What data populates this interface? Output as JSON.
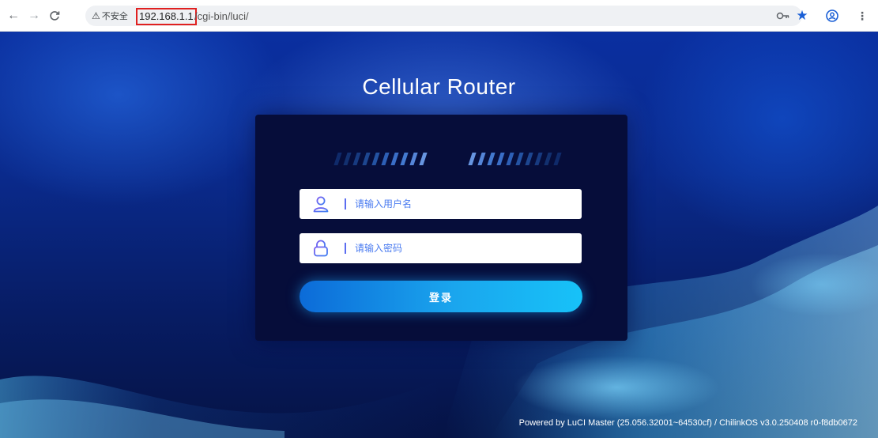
{
  "browser": {
    "security_label": "不安全",
    "url_host": "192.168.1.1",
    "url_path": "/cgi-bin/luci/"
  },
  "icons": {
    "back": "back-arrow-icon",
    "forward": "forward-arrow-icon",
    "reload": "reload-icon",
    "warning": "warning-icon",
    "key": "password-key-icon",
    "bookmark": "bookmark-star-icon",
    "profile": "profile-icon",
    "menu": "more-menu-icon",
    "user": "user-icon",
    "lock": "lock-icon"
  },
  "page": {
    "title": "Cellular Router",
    "username_placeholder": "请输入用户名",
    "password_placeholder": "请输入密码",
    "login_label": "登录",
    "footer": "Powered by LuCI Master (25.056.32001~64530cf) / ChilinkOS v3.0.250408 r0-f8db0672"
  },
  "colors": {
    "background": "#0a2a8c",
    "card": "#060d3a",
    "button_start": "#0c6bd8",
    "button_end": "#17c2f8",
    "url_highlight": "#e02020",
    "bookmark_star": "#1a5fd6"
  }
}
